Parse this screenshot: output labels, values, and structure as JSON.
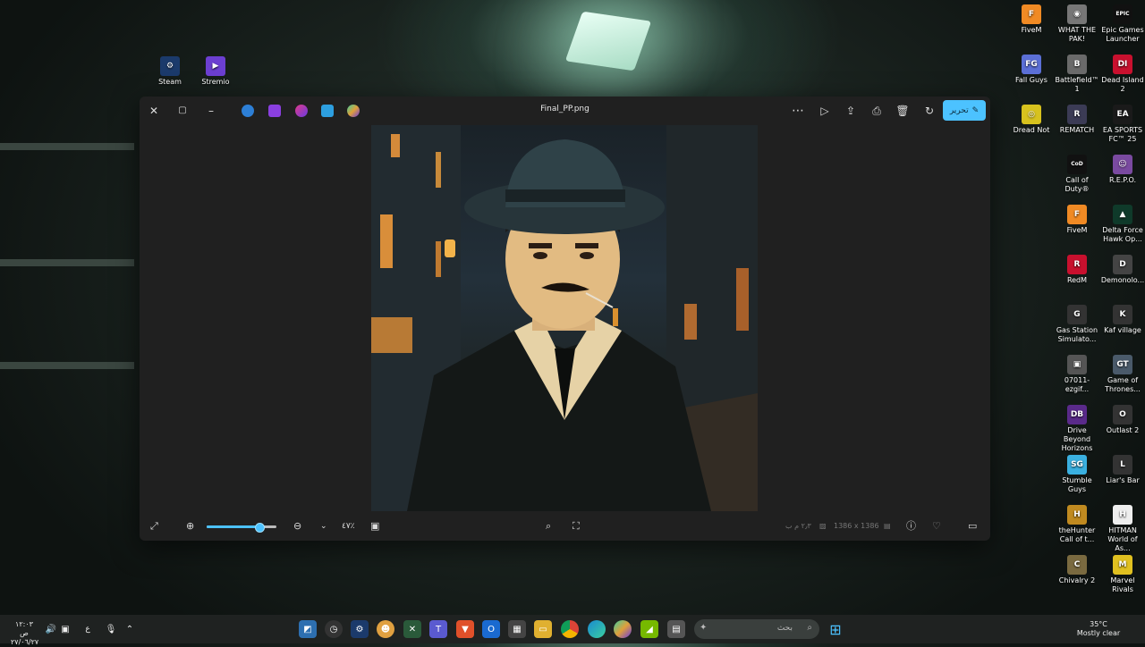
{
  "desktop_left": [
    {
      "label": "Steam",
      "color": "#1b3a6b",
      "glyph": "⚙"
    },
    {
      "label": "Stremio",
      "color": "#6c3fd1",
      "glyph": "▶"
    }
  ],
  "desktop_right": [
    {
      "label": "FiveM",
      "color": "#f08a24",
      "glyph": "F"
    },
    {
      "label": "WHAT THE PAK!",
      "color": "#777",
      "glyph": "◉"
    },
    {
      "label": "Epic Games Launcher",
      "color": "#111",
      "glyph": "EPIC"
    },
    {
      "label": "Fall Guys",
      "color": "#5b6fd6",
      "glyph": "FG"
    },
    {
      "label": "Battlefield™ 1",
      "color": "#6a6a6a",
      "glyph": "B"
    },
    {
      "label": "Dead Island 2",
      "color": "#c8102e",
      "glyph": "DI"
    },
    {
      "label": "Dread Not",
      "color": "#d7c21e",
      "glyph": "◎"
    },
    {
      "label": "REMATCH",
      "color": "#3b3b55",
      "glyph": "R"
    },
    {
      "label": "EA SPORTS FC™ 25",
      "color": "#1a1a1a",
      "glyph": "EA"
    },
    {
      "label": "Call of Duty®",
      "color": "#111",
      "glyph": "CoD"
    },
    {
      "label": "R.E.P.O.",
      "color": "#7a4aa0",
      "glyph": "☺"
    },
    {
      "label": "FiveM",
      "color": "#f08a24",
      "glyph": "F"
    },
    {
      "label": "Delta Force Hawk Op...",
      "color": "#0f3a2a",
      "glyph": "▲"
    },
    {
      "label": "RedM",
      "color": "#c8102e",
      "glyph": "R"
    },
    {
      "label": "Demonolo...",
      "color": "#444",
      "glyph": "D"
    },
    {
      "label": "Gas Station Simulato...",
      "color": "#333",
      "glyph": "G"
    },
    {
      "label": "Kaf village",
      "color": "#333",
      "glyph": "K"
    },
    {
      "label": "07011-ezgif...",
      "color": "#555",
      "glyph": "▣"
    },
    {
      "label": "Game of Thrones...",
      "color": "#4a5a6a",
      "glyph": "GT"
    },
    {
      "label": "Drive Beyond Horizons",
      "color": "#5a2a8a",
      "glyph": "DB"
    },
    {
      "label": "Outlast 2",
      "color": "#333",
      "glyph": "O"
    },
    {
      "label": "Stumble Guys",
      "color": "#3ab0e0",
      "glyph": "SG"
    },
    {
      "label": "Liar's Bar",
      "color": "#333",
      "glyph": "L"
    },
    {
      "label": "theHunter Call of t...",
      "color": "#c08a20",
      "glyph": "H"
    },
    {
      "label": "HITMAN World of As...",
      "color": "#eee",
      "glyph": "H"
    },
    {
      "label": "Chivalry 2",
      "color": "#7a6a40",
      "glyph": "C"
    },
    {
      "label": "Marvel Rivals",
      "color": "#e0c020",
      "glyph": "M"
    }
  ],
  "viewer": {
    "file_name": "Final_PP.png",
    "edit_label": "تحرير",
    "zoom_level": "٤٧٪",
    "zoom_fraction": 0.75,
    "dimensions": "1386 x 1386",
    "file_size": "٢٫٣ م ب"
  },
  "taskbar": {
    "search_placeholder": "بحث",
    "weather_temp": "35°C",
    "weather_desc": "Mostly clear",
    "time": "١٢:٠٣ ص",
    "date": "٢٧/٠٦/٢٧",
    "lang": "ع"
  }
}
